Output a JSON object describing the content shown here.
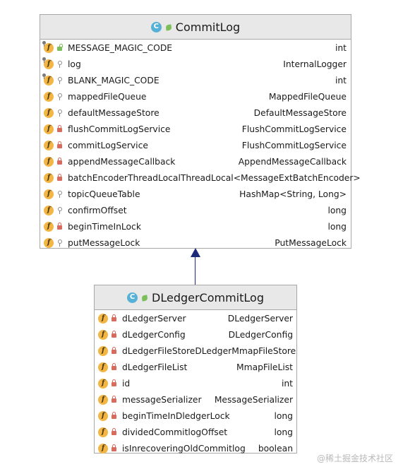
{
  "parent_class": {
    "name": "CommitLog",
    "icon": "class-icon",
    "fields": [
      {
        "name": "MESSAGE_MAGIC_CODE",
        "type": "int",
        "static": true,
        "access": "public"
      },
      {
        "name": "log",
        "type": "InternalLogger",
        "static": true,
        "access": "package"
      },
      {
        "name": "BLANK_MAGIC_CODE",
        "type": "int",
        "static": true,
        "access": "package"
      },
      {
        "name": "mappedFileQueue",
        "type": "MappedFileQueue",
        "static": false,
        "access": "package"
      },
      {
        "name": "defaultMessageStore",
        "type": "DefaultMessageStore",
        "static": false,
        "access": "package"
      },
      {
        "name": "flushCommitLogService",
        "type": "FlushCommitLogService",
        "static": false,
        "access": "private"
      },
      {
        "name": "commitLogService",
        "type": "FlushCommitLogService",
        "static": false,
        "access": "private"
      },
      {
        "name": "appendMessageCallback",
        "type": "AppendMessageCallback",
        "static": false,
        "access": "private"
      },
      {
        "name": "batchEncoderThreadLocal",
        "type": "ThreadLocal<MessageExtBatchEncoder>",
        "static": false,
        "access": "private"
      },
      {
        "name": "topicQueueTable",
        "type": "HashMap<String, Long>",
        "static": false,
        "access": "package"
      },
      {
        "name": "confirmOffset",
        "type": "long",
        "static": false,
        "access": "package"
      },
      {
        "name": "beginTimeInLock",
        "type": "long",
        "static": false,
        "access": "private"
      },
      {
        "name": "putMessageLock",
        "type": "PutMessageLock",
        "static": false,
        "access": "package"
      }
    ]
  },
  "child_class": {
    "name": "DLedgerCommitLog",
    "icon": "class-icon",
    "fields": [
      {
        "name": "dLedgerServer",
        "type": "DLedgerServer",
        "static": false,
        "access": "private"
      },
      {
        "name": "dLedgerConfig",
        "type": "DLedgerConfig",
        "static": false,
        "access": "private"
      },
      {
        "name": "dLedgerFileStore",
        "type": "DLedgerMmapFileStore",
        "static": false,
        "access": "private"
      },
      {
        "name": "dLedgerFileList",
        "type": "MmapFileList",
        "static": false,
        "access": "private"
      },
      {
        "name": "id",
        "type": "int",
        "static": false,
        "access": "private"
      },
      {
        "name": "messageSerializer",
        "type": "MessageSerializer",
        "static": false,
        "access": "private"
      },
      {
        "name": "beginTimeInDledgerLock",
        "type": "long",
        "static": false,
        "access": "private"
      },
      {
        "name": "dividedCommitlogOffset",
        "type": "long",
        "static": false,
        "access": "private"
      },
      {
        "name": "isInrecoveringOldCommitlog",
        "type": "boolean",
        "static": false,
        "access": "private"
      }
    ]
  },
  "relationship": "inheritance",
  "watermark": "@稀土掘金技术社区",
  "colors": {
    "header_bg": "#e8e8e8",
    "border": "#a8a8a8",
    "field_icon": "#f3b544",
    "class_icon": "#57b1d6",
    "private_lock": "#d96a5e",
    "arrow": "#1d2a7a"
  }
}
